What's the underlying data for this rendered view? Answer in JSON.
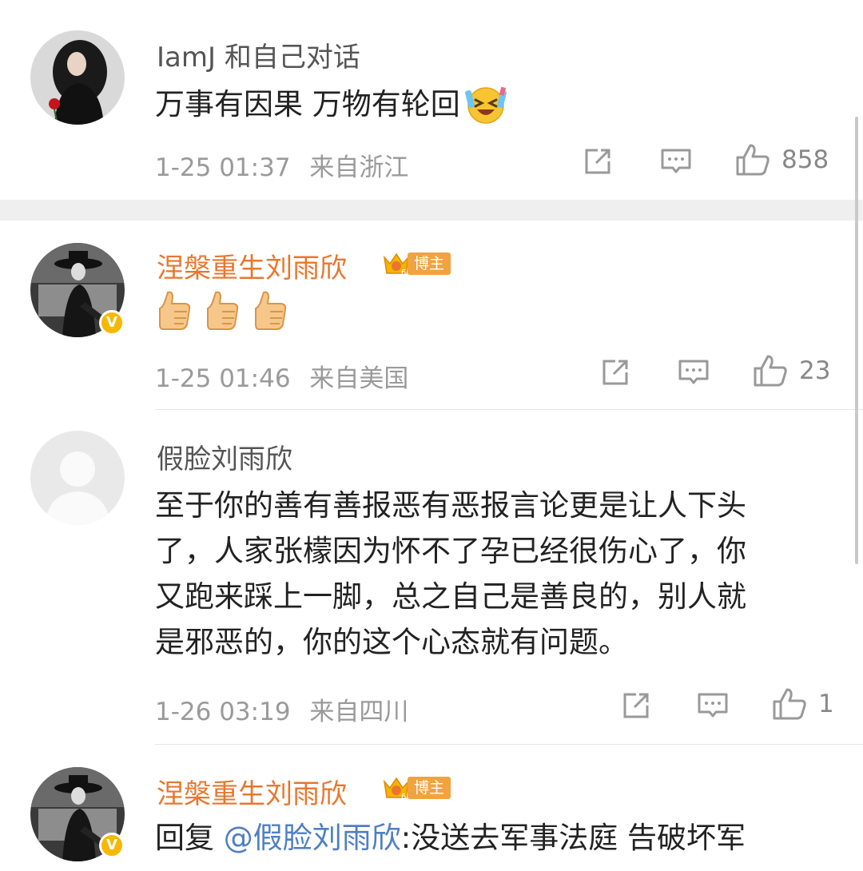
{
  "comments": [
    {
      "username": "IamJ 和自己对话",
      "text": "万事有因果 万物有轮回",
      "emoji": "laughing-crying-emoji",
      "time": "1-25 01:37",
      "location": "来自浙江",
      "likes": "858"
    },
    {
      "username": "涅槃重生刘雨欣",
      "badge": "博主",
      "crown_level": "6",
      "verified": true,
      "emoji": "thumbs-up-emoji",
      "time": "1-25 01:46",
      "location": "来自美国",
      "likes": "23"
    },
    {
      "username": "假脸刘雨欣",
      "lines": [
        "至于你的善有善报恶有恶报言论更是让人下头",
        "了，人家张檬因为怀不了孕已经很伤心了，你",
        "又跑来踩上一脚，总之自己是善良的，别人就",
        "是邪恶的，你的这个心态就有问题。"
      ],
      "time": "1-26 03:19",
      "location": "来自四川",
      "likes": "1"
    },
    {
      "username": "涅槃重生刘雨欣",
      "badge": "博主",
      "crown_level": "6",
      "verified": true,
      "reply_prefix": "回复 ",
      "mention": "@假脸刘雨欣",
      "text": ":没送去军事法庭 告破坏军"
    }
  ],
  "icons": {
    "share": "share-icon",
    "comment": "comment-icon",
    "like": "like-icon"
  },
  "colors": {
    "host_name": "#e8772d",
    "badge": "#f0a340",
    "verified": "#f6b800",
    "mention": "#4f7fc2",
    "meta": "#9a9a9a"
  }
}
